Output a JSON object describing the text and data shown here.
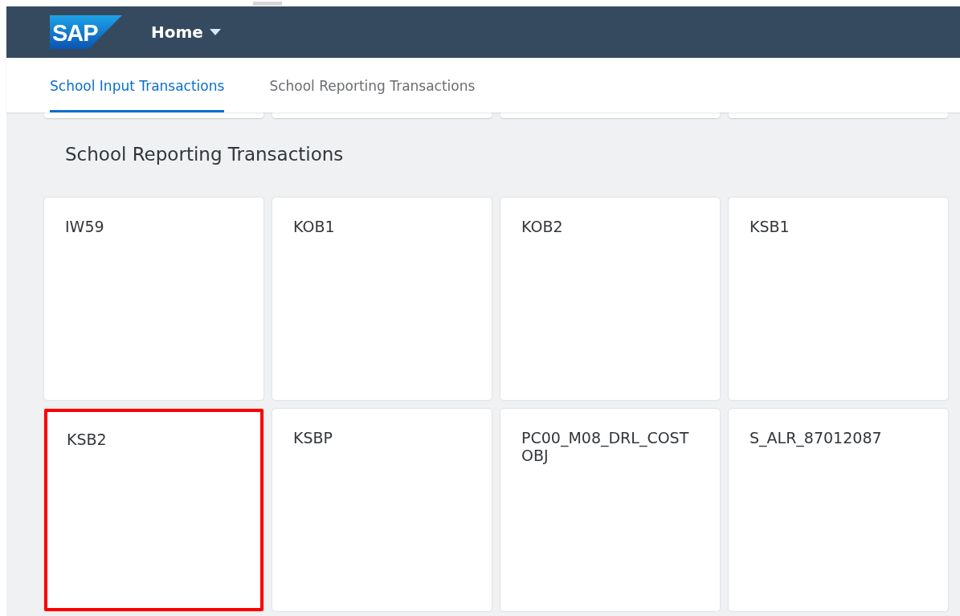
{
  "header": {
    "logo": "SAP",
    "title": "Home"
  },
  "tabs": [
    {
      "label": "School Input Transactions",
      "selected": true
    },
    {
      "label": "School Reporting Transactions",
      "selected": false
    }
  ],
  "section": {
    "title": "School Reporting Transactions",
    "tiles": [
      {
        "title": "IW59",
        "highlighted": false
      },
      {
        "title": "KOB1",
        "highlighted": false
      },
      {
        "title": "KOB2",
        "highlighted": false
      },
      {
        "title": "KSB1",
        "highlighted": false
      },
      {
        "title": "KSB2",
        "highlighted": true
      },
      {
        "title": "KSBP",
        "highlighted": false
      },
      {
        "title": "PC00_M08_DRL_COSTOBJ",
        "highlighted": false
      },
      {
        "title": "S_ALR_87012087",
        "highlighted": false
      }
    ]
  }
}
